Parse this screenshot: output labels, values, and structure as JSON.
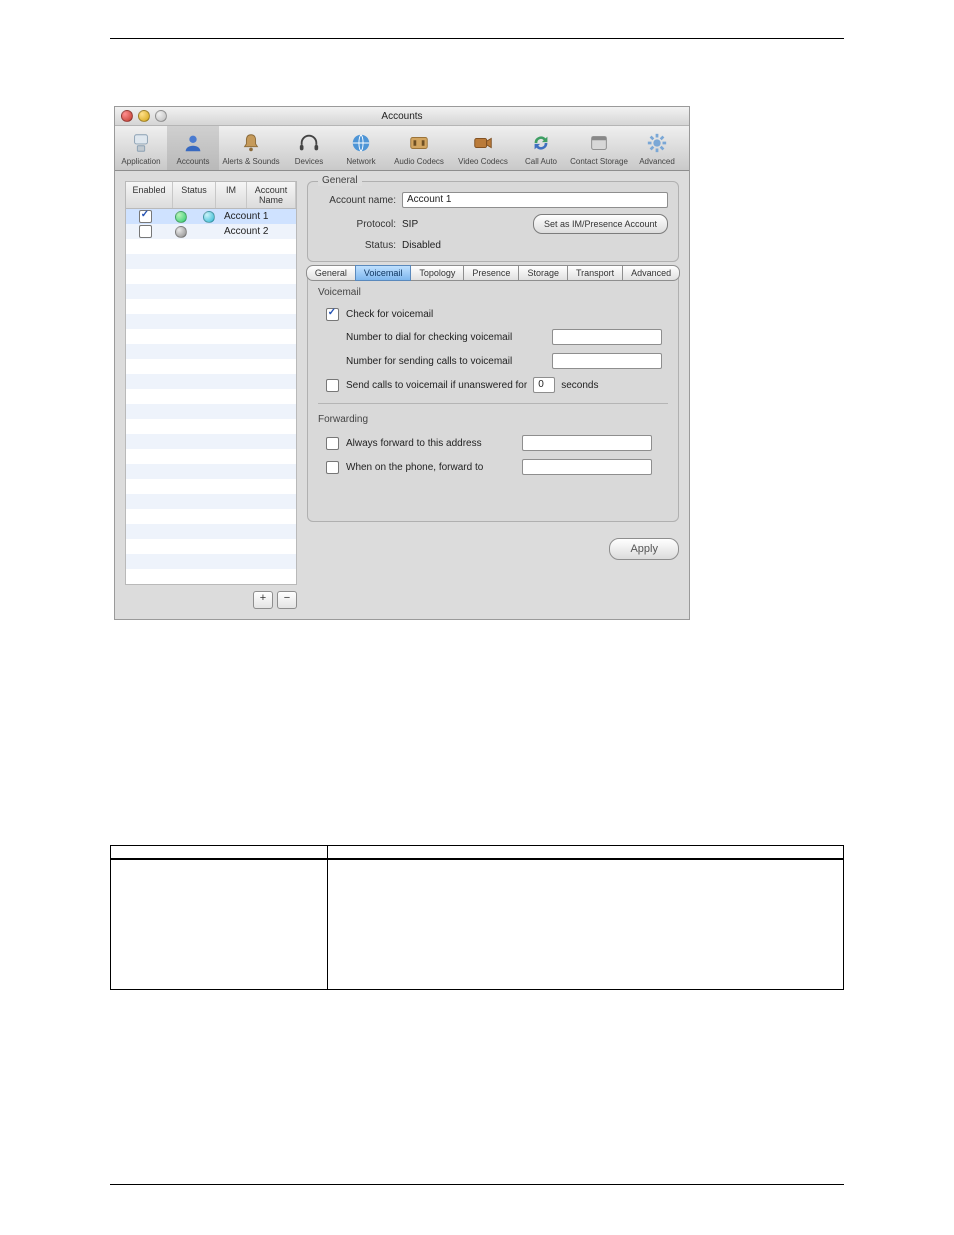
{
  "window": {
    "title": "Accounts"
  },
  "toolbar": {
    "items": [
      {
        "label": "Application"
      },
      {
        "label": "Accounts"
      },
      {
        "label": "Alerts & Sounds"
      },
      {
        "label": "Devices"
      },
      {
        "label": "Network"
      },
      {
        "label": "Audio Codecs"
      },
      {
        "label": "Video Codecs"
      },
      {
        "label": "Call Auto"
      },
      {
        "label": "Contact Storage"
      },
      {
        "label": "Advanced"
      }
    ]
  },
  "accounts_list": {
    "headers": {
      "enabled": "Enabled",
      "status": "Status",
      "im": "IM",
      "account_name": "Account Name"
    },
    "rows": [
      {
        "enabled": true,
        "status": "green",
        "im": "cyan",
        "name": "Account 1"
      },
      {
        "enabled": false,
        "status": "gray",
        "im": "",
        "name": "Account 2"
      }
    ],
    "add_label": "+",
    "remove_label": "−"
  },
  "general_panel": {
    "title": "General",
    "account_name_label": "Account name:",
    "account_name_value": "Account 1",
    "protocol_label": "Protocol:",
    "protocol_value": "SIP",
    "status_label": "Status:",
    "status_value": "Disabled",
    "im_button": "Set as IM/Presence Account"
  },
  "detail_tabs": {
    "items": [
      {
        "label": "General"
      },
      {
        "label": "Voicemail"
      },
      {
        "label": "Topology"
      },
      {
        "label": "Presence"
      },
      {
        "label": "Storage"
      },
      {
        "label": "Transport"
      },
      {
        "label": "Advanced"
      }
    ],
    "selected_index": 1
  },
  "voicemail_section": {
    "title": "Voicemail",
    "check_label": "Check for voicemail",
    "check_checked": true,
    "dial_label": "Number to dial for checking voicemail",
    "dial_value": "",
    "send_label": "Number for sending calls to voicemail",
    "send_value": "",
    "unanswer_label_pre": "Send calls to voicemail if unanswered for",
    "unanswer_value": "0",
    "unanswer_label_post": "seconds",
    "unanswer_checked": false
  },
  "forwarding_section": {
    "title": "Forwarding",
    "always_label": "Always forward to this address",
    "always_value": "",
    "always_checked": false,
    "busy_label": "When on the phone, forward to",
    "busy_value": "",
    "busy_checked": false
  },
  "apply_label": "Apply"
}
